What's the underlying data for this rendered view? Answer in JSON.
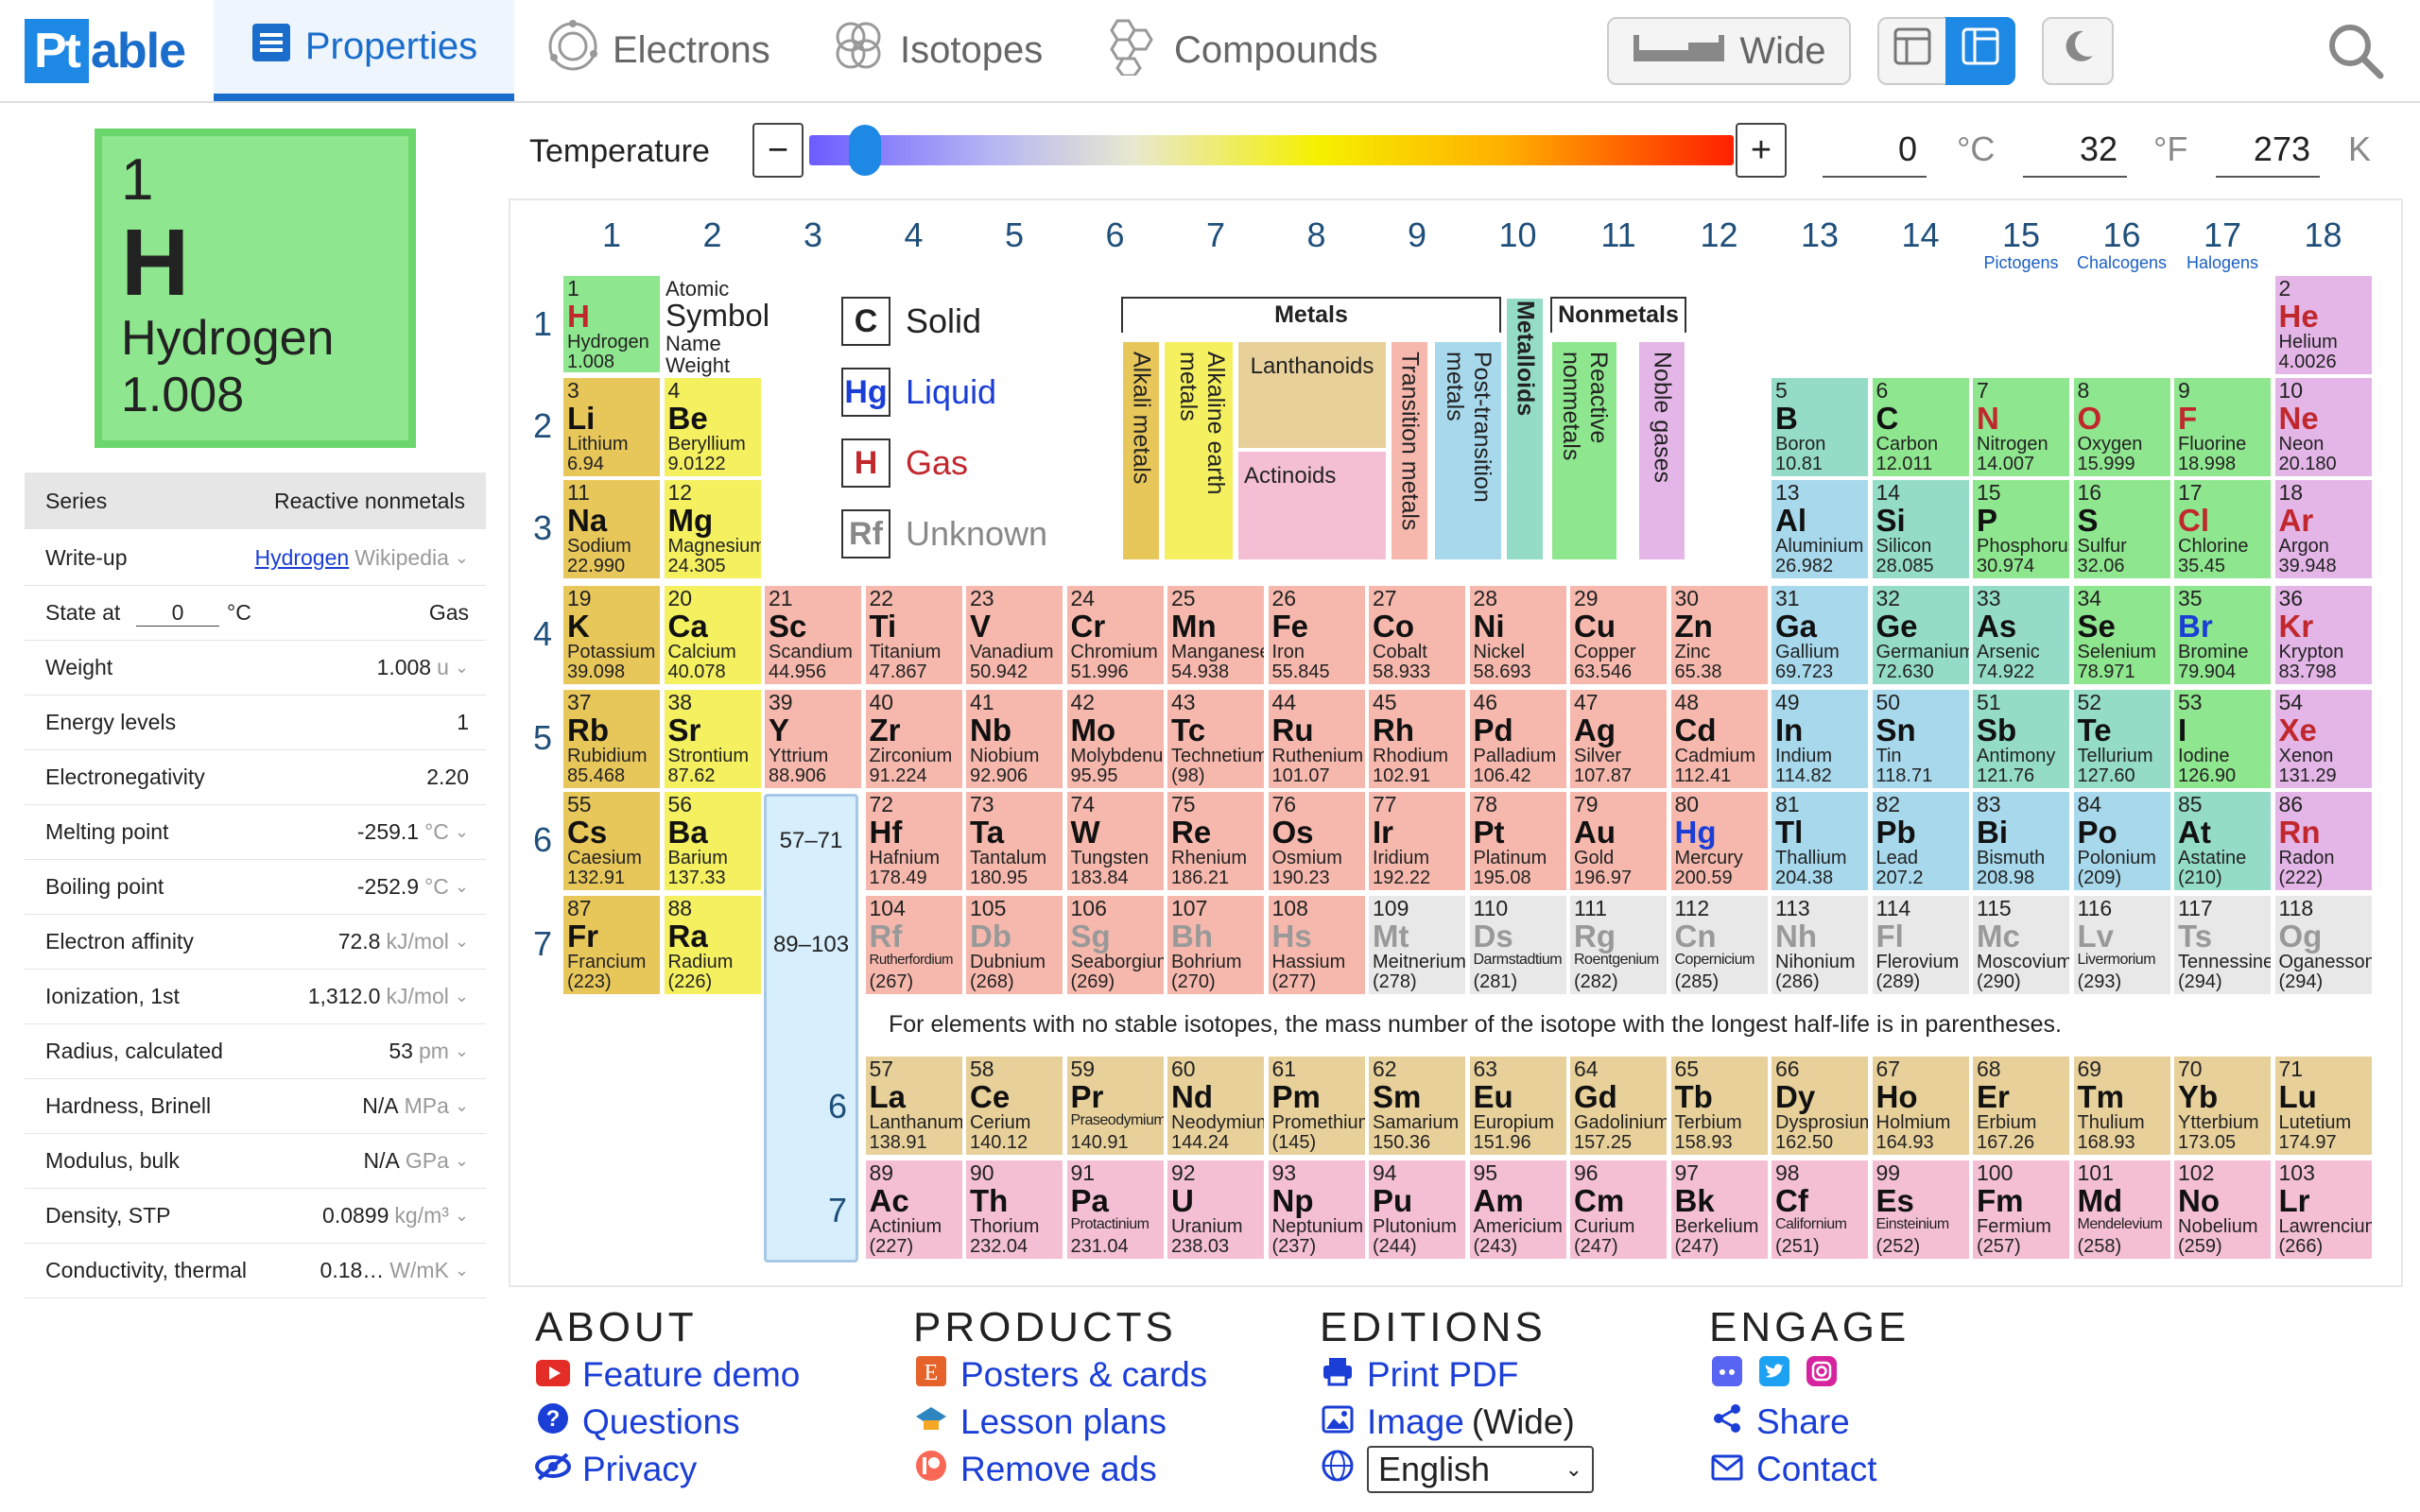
{
  "logo": {
    "pt": "Pt",
    "rest": "able"
  },
  "tabs": [
    {
      "label": "Properties"
    },
    {
      "label": "Electrons"
    },
    {
      "label": "Isotopes"
    },
    {
      "label": "Compounds"
    }
  ],
  "toolbar": {
    "wide_label": "Wide"
  },
  "selected": {
    "number": "1",
    "symbol": "H",
    "name": "Hydrogen",
    "weight": "1.008"
  },
  "series": {
    "label": "Series",
    "value": "Reactive nonmetals"
  },
  "props": [
    {
      "label": "Write-up",
      "value": "Hydrogen",
      "extra": "Wikipedia"
    },
    {
      "label": "State at",
      "value": "Gas",
      "input": "0",
      "unit": "°C"
    },
    {
      "label": "Weight",
      "value": "1.008",
      "unit": "u"
    },
    {
      "label": "Energy levels",
      "value": "1"
    },
    {
      "label": "Electronegativity",
      "value": "2.20"
    },
    {
      "label": "Melting point",
      "value": "-259.1",
      "unit": "°C"
    },
    {
      "label": "Boiling point",
      "value": "-252.9",
      "unit": "°C"
    },
    {
      "label": "Electron affinity",
      "value": "72.8",
      "unit": "kJ/mol"
    },
    {
      "label": "Ionization, 1st",
      "value": "1,312.0",
      "unit": "kJ/mol"
    },
    {
      "label": "Radius, calculated",
      "value": "53",
      "unit": "pm"
    },
    {
      "label": "Hardness, Brinell",
      "value": "N/A",
      "unit": "MPa"
    },
    {
      "label": "Modulus, bulk",
      "value": "N/A",
      "unit": "GPa"
    },
    {
      "label": "Density, STP",
      "value": "0.0899",
      "unit": "kg/m³"
    },
    {
      "label": "Conductivity, thermal",
      "value": "0.18…",
      "unit": "W/mK"
    }
  ],
  "temperature": {
    "label": "Temperature",
    "celsius": "0",
    "c_unit": "°C",
    "fahrenheit": "32",
    "f_unit": "°F",
    "kelvin": "273",
    "k_unit": "K",
    "level": 0.06
  },
  "groups": [
    "1",
    "2",
    "3",
    "4",
    "5",
    "6",
    "7",
    "8",
    "9",
    "10",
    "11",
    "12",
    "13",
    "14",
    "15",
    "16",
    "17",
    "18"
  ],
  "group_subs": {
    "15": "Pictogens",
    "16": "Chalcogens",
    "17": "Halogens"
  },
  "periods": [
    "1",
    "2",
    "3",
    "4",
    "5",
    "6",
    "7"
  ],
  "key": {
    "number": "1",
    "symbol_hint": "Symbol",
    "atomic": "Atomic",
    "name": "Name",
    "weight": "Weight",
    "el_symbol": "H",
    "el_name": "Hydrogen",
    "el_weight": "1.008"
  },
  "states": [
    {
      "box": "C",
      "label": "Solid",
      "color": "#222"
    },
    {
      "box": "Hg",
      "label": "Liquid",
      "color": "#1a3ed6"
    },
    {
      "box": "H",
      "label": "Gas",
      "color": "#c0282d"
    },
    {
      "box": "Rf",
      "label": "Unknown",
      "color": "#888"
    }
  ],
  "categories": {
    "metals": "Metals",
    "nonmetals": "Nonmetals",
    "alkali": "Alkali metals",
    "alkaline": "Alkaline earth metals",
    "lanthanoids": "Lanthanoids",
    "actinoids": "Actinoids",
    "transition": "Transition metals",
    "post": "Post-transition metals",
    "metalloids": "Metalloids",
    "reactive": "Reactive nonmetals",
    "noble": "Noble gases"
  },
  "placeholders": {
    "la": "57–71",
    "ac": "89–103",
    "f6": "6",
    "f7": "7"
  },
  "note": "For elements with no stable isotopes, the mass number of the isotope with the longest half-life is in parentheses.",
  "elements": [
    [
      "1",
      "H",
      "Hydrogen",
      "1.008",
      1,
      1,
      "rn",
      "g"
    ],
    [
      "2",
      "He",
      "Helium",
      "4.0026",
      18,
      1,
      "ng",
      "g"
    ],
    [
      "3",
      "Li",
      "Lithium",
      "6.94",
      1,
      2,
      "alk",
      "s"
    ],
    [
      "4",
      "Be",
      "Beryllium",
      "9.0122",
      2,
      2,
      "ae",
      "s"
    ],
    [
      "5",
      "B",
      "Boron",
      "10.81",
      13,
      2,
      "me",
      "s"
    ],
    [
      "6",
      "C",
      "Carbon",
      "12.011",
      14,
      2,
      "rn",
      "s"
    ],
    [
      "7",
      "N",
      "Nitrogen",
      "14.007",
      15,
      2,
      "rn",
      "g"
    ],
    [
      "8",
      "O",
      "Oxygen",
      "15.999",
      16,
      2,
      "rn",
      "g"
    ],
    [
      "9",
      "F",
      "Fluorine",
      "18.998",
      17,
      2,
      "rn",
      "g"
    ],
    [
      "10",
      "Ne",
      "Neon",
      "20.180",
      18,
      2,
      "ng",
      "g"
    ],
    [
      "11",
      "Na",
      "Sodium",
      "22.990",
      1,
      3,
      "alk",
      "s"
    ],
    [
      "12",
      "Mg",
      "Magnesium",
      "24.305",
      2,
      3,
      "ae",
      "s"
    ],
    [
      "13",
      "Al",
      "Aluminium",
      "26.982",
      13,
      3,
      "pt",
      "s"
    ],
    [
      "14",
      "Si",
      "Silicon",
      "28.085",
      14,
      3,
      "me",
      "s"
    ],
    [
      "15",
      "P",
      "Phosphorus",
      "30.974",
      15,
      3,
      "rn",
      "s"
    ],
    [
      "16",
      "S",
      "Sulfur",
      "32.06",
      16,
      3,
      "rn",
      "s"
    ],
    [
      "17",
      "Cl",
      "Chlorine",
      "35.45",
      17,
      3,
      "rn",
      "g"
    ],
    [
      "18",
      "Ar",
      "Argon",
      "39.948",
      18,
      3,
      "ng",
      "g"
    ],
    [
      "19",
      "K",
      "Potassium",
      "39.098",
      1,
      4,
      "alk",
      "s"
    ],
    [
      "20",
      "Ca",
      "Calcium",
      "40.078",
      2,
      4,
      "ae",
      "s"
    ],
    [
      "21",
      "Sc",
      "Scandium",
      "44.956",
      3,
      4,
      "tm",
      "s"
    ],
    [
      "22",
      "Ti",
      "Titanium",
      "47.867",
      4,
      4,
      "tm",
      "s"
    ],
    [
      "23",
      "V",
      "Vanadium",
      "50.942",
      5,
      4,
      "tm",
      "s"
    ],
    [
      "24",
      "Cr",
      "Chromium",
      "51.996",
      6,
      4,
      "tm",
      "s"
    ],
    [
      "25",
      "Mn",
      "Manganese",
      "54.938",
      7,
      4,
      "tm",
      "s"
    ],
    [
      "26",
      "Fe",
      "Iron",
      "55.845",
      8,
      4,
      "tm",
      "s"
    ],
    [
      "27",
      "Co",
      "Cobalt",
      "58.933",
      9,
      4,
      "tm",
      "s"
    ],
    [
      "28",
      "Ni",
      "Nickel",
      "58.693",
      10,
      4,
      "tm",
      "s"
    ],
    [
      "29",
      "Cu",
      "Copper",
      "63.546",
      11,
      4,
      "tm",
      "s"
    ],
    [
      "30",
      "Zn",
      "Zinc",
      "65.38",
      12,
      4,
      "tm",
      "s"
    ],
    [
      "31",
      "Ga",
      "Gallium",
      "69.723",
      13,
      4,
      "pt",
      "s"
    ],
    [
      "32",
      "Ge",
      "Germanium",
      "72.630",
      14,
      4,
      "me",
      "s"
    ],
    [
      "33",
      "As",
      "Arsenic",
      "74.922",
      15,
      4,
      "me",
      "s"
    ],
    [
      "34",
      "Se",
      "Selenium",
      "78.971",
      16,
      4,
      "rn",
      "s"
    ],
    [
      "35",
      "Br",
      "Bromine",
      "79.904",
      17,
      4,
      "rn",
      "l"
    ],
    [
      "36",
      "Kr",
      "Krypton",
      "83.798",
      18,
      4,
      "ng",
      "g"
    ],
    [
      "37",
      "Rb",
      "Rubidium",
      "85.468",
      1,
      5,
      "alk",
      "s"
    ],
    [
      "38",
      "Sr",
      "Strontium",
      "87.62",
      2,
      5,
      "ae",
      "s"
    ],
    [
      "39",
      "Y",
      "Yttrium",
      "88.906",
      3,
      5,
      "tm",
      "s"
    ],
    [
      "40",
      "Zr",
      "Zirconium",
      "91.224",
      4,
      5,
      "tm",
      "s"
    ],
    [
      "41",
      "Nb",
      "Niobium",
      "92.906",
      5,
      5,
      "tm",
      "s"
    ],
    [
      "42",
      "Mo",
      "Molybdenum",
      "95.95",
      6,
      5,
      "tm",
      "s"
    ],
    [
      "43",
      "Tc",
      "Technetium",
      "(98)",
      7,
      5,
      "tm",
      "s"
    ],
    [
      "44",
      "Ru",
      "Ruthenium",
      "101.07",
      8,
      5,
      "tm",
      "s"
    ],
    [
      "45",
      "Rh",
      "Rhodium",
      "102.91",
      9,
      5,
      "tm",
      "s"
    ],
    [
      "46",
      "Pd",
      "Palladium",
      "106.42",
      10,
      5,
      "tm",
      "s"
    ],
    [
      "47",
      "Ag",
      "Silver",
      "107.87",
      11,
      5,
      "tm",
      "s"
    ],
    [
      "48",
      "Cd",
      "Cadmium",
      "112.41",
      12,
      5,
      "tm",
      "s"
    ],
    [
      "49",
      "In",
      "Indium",
      "114.82",
      13,
      5,
      "pt",
      "s"
    ],
    [
      "50",
      "Sn",
      "Tin",
      "118.71",
      14,
      5,
      "pt",
      "s"
    ],
    [
      "51",
      "Sb",
      "Antimony",
      "121.76",
      15,
      5,
      "me",
      "s"
    ],
    [
      "52",
      "Te",
      "Tellurium",
      "127.60",
      16,
      5,
      "me",
      "s"
    ],
    [
      "53",
      "I",
      "Iodine",
      "126.90",
      17,
      5,
      "rn",
      "s"
    ],
    [
      "54",
      "Xe",
      "Xenon",
      "131.29",
      18,
      5,
      "ng",
      "g"
    ],
    [
      "55",
      "Cs",
      "Caesium",
      "132.91",
      1,
      6,
      "alk",
      "s"
    ],
    [
      "56",
      "Ba",
      "Barium",
      "137.33",
      2,
      6,
      "ae",
      "s"
    ],
    [
      "72",
      "Hf",
      "Hafnium",
      "178.49",
      4,
      6,
      "tm",
      "s"
    ],
    [
      "73",
      "Ta",
      "Tantalum",
      "180.95",
      5,
      6,
      "tm",
      "s"
    ],
    [
      "74",
      "W",
      "Tungsten",
      "183.84",
      6,
      6,
      "tm",
      "s"
    ],
    [
      "75",
      "Re",
      "Rhenium",
      "186.21",
      7,
      6,
      "tm",
      "s"
    ],
    [
      "76",
      "Os",
      "Osmium",
      "190.23",
      8,
      6,
      "tm",
      "s"
    ],
    [
      "77",
      "Ir",
      "Iridium",
      "192.22",
      9,
      6,
      "tm",
      "s"
    ],
    [
      "78",
      "Pt",
      "Platinum",
      "195.08",
      10,
      6,
      "tm",
      "s"
    ],
    [
      "79",
      "Au",
      "Gold",
      "196.97",
      11,
      6,
      "tm",
      "s"
    ],
    [
      "80",
      "Hg",
      "Mercury",
      "200.59",
      12,
      6,
      "tm",
      "l"
    ],
    [
      "81",
      "Tl",
      "Thallium",
      "204.38",
      13,
      6,
      "pt",
      "s"
    ],
    [
      "82",
      "Pb",
      "Lead",
      "207.2",
      14,
      6,
      "pt",
      "s"
    ],
    [
      "83",
      "Bi",
      "Bismuth",
      "208.98",
      15,
      6,
      "pt",
      "s"
    ],
    [
      "84",
      "Po",
      "Polonium",
      "(209)",
      16,
      6,
      "pt",
      "s"
    ],
    [
      "85",
      "At",
      "Astatine",
      "(210)",
      17,
      6,
      "me",
      "s"
    ],
    [
      "86",
      "Rn",
      "Radon",
      "(222)",
      18,
      6,
      "ng",
      "g"
    ],
    [
      "87",
      "Fr",
      "Francium",
      "(223)",
      1,
      7,
      "alk",
      "s"
    ],
    [
      "88",
      "Ra",
      "Radium",
      "(226)",
      2,
      7,
      "ae",
      "s"
    ],
    [
      "104",
      "Rf",
      "Rutherfordium",
      "(267)",
      4,
      7,
      "tm",
      "u"
    ],
    [
      "105",
      "Db",
      "Dubnium",
      "(268)",
      5,
      7,
      "tm",
      "u"
    ],
    [
      "106",
      "Sg",
      "Seaborgium",
      "(269)",
      6,
      7,
      "tm",
      "u"
    ],
    [
      "107",
      "Bh",
      "Bohrium",
      "(270)",
      7,
      7,
      "tm",
      "u"
    ],
    [
      "108",
      "Hs",
      "Hassium",
      "(277)",
      8,
      7,
      "tm",
      "u"
    ],
    [
      "109",
      "Mt",
      "Meitnerium",
      "(278)",
      9,
      7,
      "un",
      "u"
    ],
    [
      "110",
      "Ds",
      "Darmstadtium",
      "(281)",
      10,
      7,
      "un",
      "u"
    ],
    [
      "111",
      "Rg",
      "Roentgenium",
      "(282)",
      11,
      7,
      "un",
      "u"
    ],
    [
      "112",
      "Cn",
      "Copernicium",
      "(285)",
      12,
      7,
      "un",
      "u"
    ],
    [
      "113",
      "Nh",
      "Nihonium",
      "(286)",
      13,
      7,
      "un",
      "u"
    ],
    [
      "114",
      "Fl",
      "Flerovium",
      "(289)",
      14,
      7,
      "un",
      "u"
    ],
    [
      "115",
      "Mc",
      "Moscovium",
      "(290)",
      15,
      7,
      "un",
      "u"
    ],
    [
      "116",
      "Lv",
      "Livermorium",
      "(293)",
      16,
      7,
      "un",
      "u"
    ],
    [
      "117",
      "Ts",
      "Tennessine",
      "(294)",
      17,
      7,
      "un",
      "u"
    ],
    [
      "118",
      "Og",
      "Oganesson",
      "(294)",
      18,
      7,
      "un",
      "u"
    ],
    [
      "57",
      "La",
      "Lanthanum",
      "138.91",
      4,
      8,
      "la",
      "s"
    ],
    [
      "58",
      "Ce",
      "Cerium",
      "140.12",
      5,
      8,
      "la",
      "s"
    ],
    [
      "59",
      "Pr",
      "Praseodymium",
      "140.91",
      6,
      8,
      "la",
      "s"
    ],
    [
      "60",
      "Nd",
      "Neodymium",
      "144.24",
      7,
      8,
      "la",
      "s"
    ],
    [
      "61",
      "Pm",
      "Promethium",
      "(145)",
      8,
      8,
      "la",
      "s"
    ],
    [
      "62",
      "Sm",
      "Samarium",
      "150.36",
      9,
      8,
      "la",
      "s"
    ],
    [
      "63",
      "Eu",
      "Europium",
      "151.96",
      10,
      8,
      "la",
      "s"
    ],
    [
      "64",
      "Gd",
      "Gadolinium",
      "157.25",
      11,
      8,
      "la",
      "s"
    ],
    [
      "65",
      "Tb",
      "Terbium",
      "158.93",
      12,
      8,
      "la",
      "s"
    ],
    [
      "66",
      "Dy",
      "Dysprosium",
      "162.50",
      13,
      8,
      "la",
      "s"
    ],
    [
      "67",
      "Ho",
      "Holmium",
      "164.93",
      14,
      8,
      "la",
      "s"
    ],
    [
      "68",
      "Er",
      "Erbium",
      "167.26",
      15,
      8,
      "la",
      "s"
    ],
    [
      "69",
      "Tm",
      "Thulium",
      "168.93",
      16,
      8,
      "la",
      "s"
    ],
    [
      "70",
      "Yb",
      "Ytterbium",
      "173.05",
      17,
      8,
      "la",
      "s"
    ],
    [
      "71",
      "Lu",
      "Lutetium",
      "174.97",
      18,
      8,
      "la",
      "s"
    ],
    [
      "89",
      "Ac",
      "Actinium",
      "(227)",
      4,
      9,
      "ac",
      "s"
    ],
    [
      "90",
      "Th",
      "Thorium",
      "232.04",
      5,
      9,
      "ac",
      "s"
    ],
    [
      "91",
      "Pa",
      "Protactinium",
      "231.04",
      6,
      9,
      "ac",
      "s"
    ],
    [
      "92",
      "U",
      "Uranium",
      "238.03",
      7,
      9,
      "ac",
      "s"
    ],
    [
      "93",
      "Np",
      "Neptunium",
      "(237)",
      8,
      9,
      "ac",
      "s"
    ],
    [
      "94",
      "Pu",
      "Plutonium",
      "(244)",
      9,
      9,
      "ac",
      "s"
    ],
    [
      "95",
      "Am",
      "Americium",
      "(243)",
      10,
      9,
      "ac",
      "s"
    ],
    [
      "96",
      "Cm",
      "Curium",
      "(247)",
      11,
      9,
      "ac",
      "s"
    ],
    [
      "97",
      "Bk",
      "Berkelium",
      "(247)",
      12,
      9,
      "ac",
      "s"
    ],
    [
      "98",
      "Cf",
      "Californium",
      "(251)",
      13,
      9,
      "ac",
      "s"
    ],
    [
      "99",
      "Es",
      "Einsteinium",
      "(252)",
      14,
      9,
      "ac",
      "s"
    ],
    [
      "100",
      "Fm",
      "Fermium",
      "(257)",
      15,
      9,
      "ac",
      "s"
    ],
    [
      "101",
      "Md",
      "Mendelevium",
      "(258)",
      16,
      9,
      "ac",
      "s"
    ],
    [
      "102",
      "No",
      "Nobelium",
      "(259)",
      17,
      9,
      "ac",
      "s"
    ],
    [
      "103",
      "Lr",
      "Lawrencium",
      "(266)",
      18,
      9,
      "ac",
      "s"
    ]
  ],
  "footer": {
    "about": {
      "title": "ABOUT",
      "links": [
        "Feature demo",
        "Questions",
        "Privacy"
      ]
    },
    "products": {
      "title": "PRODUCTS",
      "links": [
        "Posters & cards",
        "Lesson plans",
        "Remove ads"
      ]
    },
    "editions": {
      "title": "EDITIONS",
      "links": [
        "Print PDF",
        "Image"
      ],
      "wide": "(Wide)",
      "language": "English"
    },
    "engage": {
      "title": "ENGAGE",
      "links": [
        "Share",
        "Contact"
      ]
    }
  }
}
